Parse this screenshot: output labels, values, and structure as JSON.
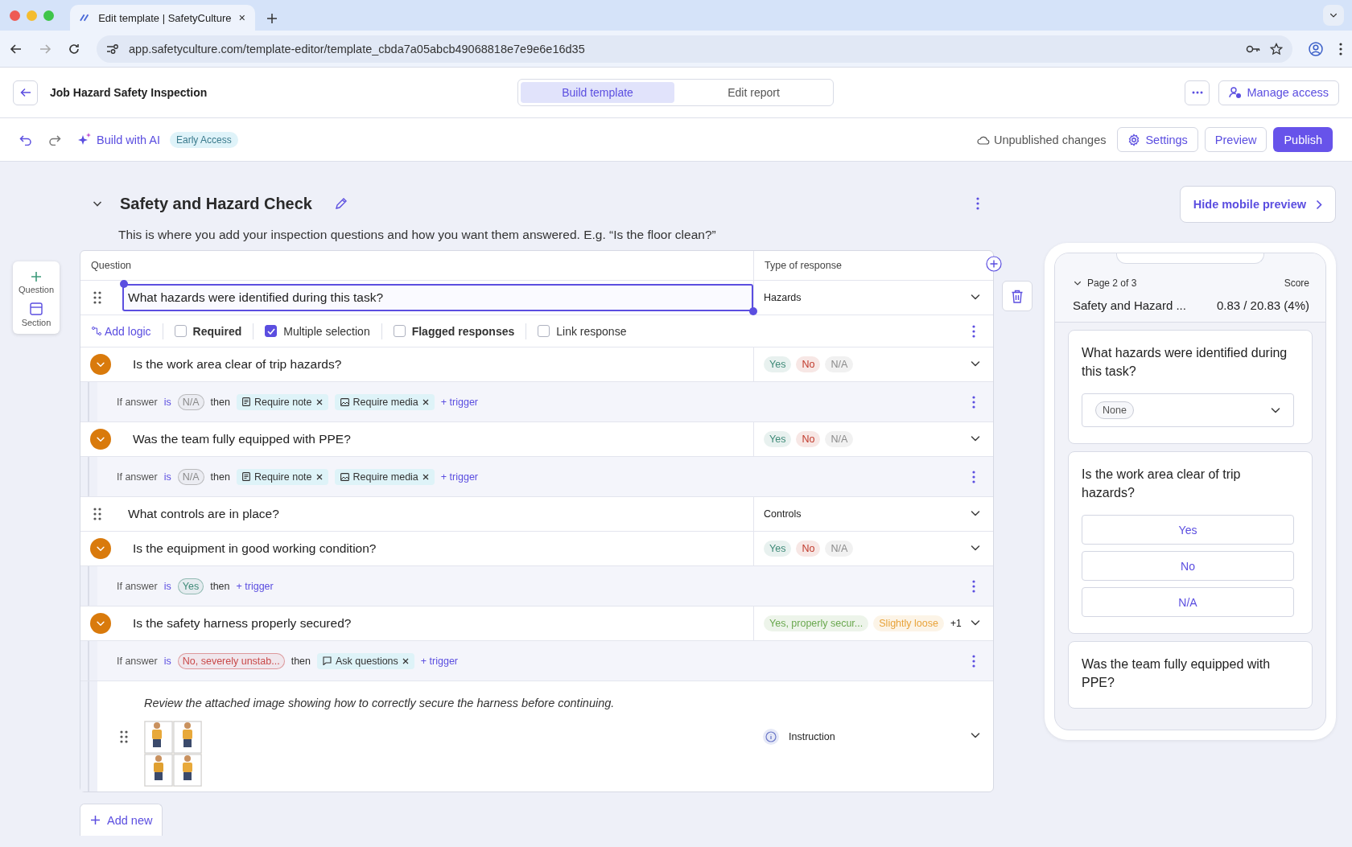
{
  "browser": {
    "tab_title": "Edit template | SafetyCulture",
    "url": "app.safetyculture.com/template-editor/template_cbda7a05abcb49068818e7e9e6e16d35"
  },
  "header": {
    "title": "Job Hazard Safety Inspection",
    "view_tabs": [
      {
        "label": "Build template",
        "selected": true
      },
      {
        "label": "Edit report",
        "selected": false
      }
    ],
    "manage_access": "Manage access"
  },
  "toolbar": {
    "ai_button": "Build with AI",
    "ai_badge": "Early Access",
    "status": "Unpublished changes",
    "settings": "Settings",
    "preview": "Preview",
    "publish": "Publish"
  },
  "side_panel": [
    {
      "label": "Question",
      "kind": "question"
    },
    {
      "label": "Section",
      "kind": "section"
    }
  ],
  "section": {
    "title": "Safety and Hazard Check",
    "expanded": true,
    "description": "This is where you add your inspection questions and how you want them answered. E.g. “Is the floor clean?”"
  },
  "table": {
    "columns": [
      "Question",
      "Type of response"
    ],
    "rows": [
      {
        "kind": "question",
        "collapsible": false,
        "selected": true,
        "text": "What hazards were identified during this task?",
        "response": {
          "kind": "text",
          "label": "Hazards"
        }
      },
      {
        "kind": "options",
        "add_logic": "Add logic",
        "checkboxes": [
          {
            "label": "Required",
            "checked": false
          },
          {
            "label": "Multiple selection",
            "checked": true
          },
          {
            "label": "Flagged responses",
            "checked": false
          },
          {
            "label": "Link response",
            "checked": false
          }
        ]
      },
      {
        "kind": "question",
        "collapsible": true,
        "selected": false,
        "text": "Is the work area clear of trip hazards?",
        "response": {
          "kind": "chips",
          "chips": [
            {
              "label": "Yes",
              "color": "#3f8a78"
            },
            {
              "label": "No",
              "color": "#c0392b"
            },
            {
              "label": "N/A",
              "color": "#8a8a8a"
            }
          ]
        }
      },
      {
        "kind": "logic",
        "parts": [
          {
            "kind": "label",
            "text": "If answer"
          },
          {
            "kind": "operator",
            "text": "is"
          },
          {
            "kind": "answer",
            "text": "N/A",
            "color": "#8a8a8a"
          },
          {
            "kind": "word",
            "text": "then"
          },
          {
            "kind": "note",
            "text": "Require note"
          },
          {
            "kind": "media",
            "text": "Require media"
          },
          {
            "kind": "trigger",
            "text": "+ trigger"
          }
        ]
      },
      {
        "kind": "question",
        "collapsible": true,
        "selected": false,
        "text": "Was the team fully equipped with PPE?",
        "response": {
          "kind": "chips",
          "chips": [
            {
              "label": "Yes",
              "color": "#3f8a78"
            },
            {
              "label": "No",
              "color": "#c0392b"
            },
            {
              "label": "N/A",
              "color": "#8a8a8a"
            }
          ]
        }
      },
      {
        "kind": "logic",
        "parts": [
          {
            "kind": "label",
            "text": "If answer"
          },
          {
            "kind": "operator",
            "text": "is"
          },
          {
            "kind": "answer",
            "text": "N/A",
            "color": "#8a8a8a"
          },
          {
            "kind": "word",
            "text": "then"
          },
          {
            "kind": "note",
            "text": "Require note"
          },
          {
            "kind": "media",
            "text": "Require media"
          },
          {
            "kind": "trigger",
            "text": "+ trigger"
          }
        ]
      },
      {
        "kind": "question",
        "collapsible": false,
        "selected": false,
        "text": "What controls are in place?",
        "response": {
          "kind": "text",
          "label": "Controls"
        }
      },
      {
        "kind": "question",
        "collapsible": true,
        "selected": false,
        "text": "Is the equipment in good working condition?",
        "response": {
          "kind": "chips",
          "chips": [
            {
              "label": "Yes",
              "color": "#3f8a78"
            },
            {
              "label": "No",
              "color": "#c0392b"
            },
            {
              "label": "N/A",
              "color": "#8a8a8a"
            }
          ]
        }
      },
      {
        "kind": "logic",
        "parts": [
          {
            "kind": "label",
            "text": "If answer"
          },
          {
            "kind": "operator",
            "text": "is"
          },
          {
            "kind": "answer",
            "text": "Yes",
            "color": "#3f8a78"
          },
          {
            "kind": "word",
            "text": "then"
          },
          {
            "kind": "trigger",
            "text": "+ trigger"
          }
        ]
      },
      {
        "kind": "question",
        "collapsible": true,
        "selected": false,
        "text": "Is the safety harness properly secured?",
        "response": {
          "kind": "chips",
          "chips": [
            {
              "label": "Yes, properly secur...",
              "color": "#6aa84f"
            },
            {
              "label": "Slightly loose",
              "color": "#e8a33a"
            }
          ],
          "more": "+1"
        }
      },
      {
        "kind": "logic",
        "parts": [
          {
            "kind": "label",
            "text": "If answer"
          },
          {
            "kind": "operator",
            "text": "is"
          },
          {
            "kind": "answer",
            "text": "No, severely unstab...",
            "color": "#c94a4a"
          },
          {
            "kind": "word",
            "text": "then"
          },
          {
            "kind": "comment",
            "text": "Ask questions"
          },
          {
            "kind": "trigger",
            "text": "+ trigger"
          }
        ]
      },
      {
        "kind": "instruction",
        "text": "Review the attached image showing how to correctly secure the harness before continuing.",
        "response": {
          "kind": "instruction",
          "label": "Instruction"
        }
      }
    ]
  },
  "add_new": "Add new",
  "mobile": {
    "toggle": "Hide mobile preview",
    "page": "Page 2 of 3",
    "score_label": "Score",
    "section": "Safety and Hazard ...",
    "score": "0.83 / 20.83 (4%)",
    "cards": [
      {
        "kind": "select",
        "question": "What hazards were identified during this task?",
        "value": "None"
      },
      {
        "kind": "buttons",
        "question": "Is the work area clear of trip hazards?",
        "options": [
          "Yes",
          "No",
          "N/A"
        ]
      },
      {
        "kind": "question_only",
        "question": "Was the team fully equipped with PPE?"
      }
    ]
  }
}
